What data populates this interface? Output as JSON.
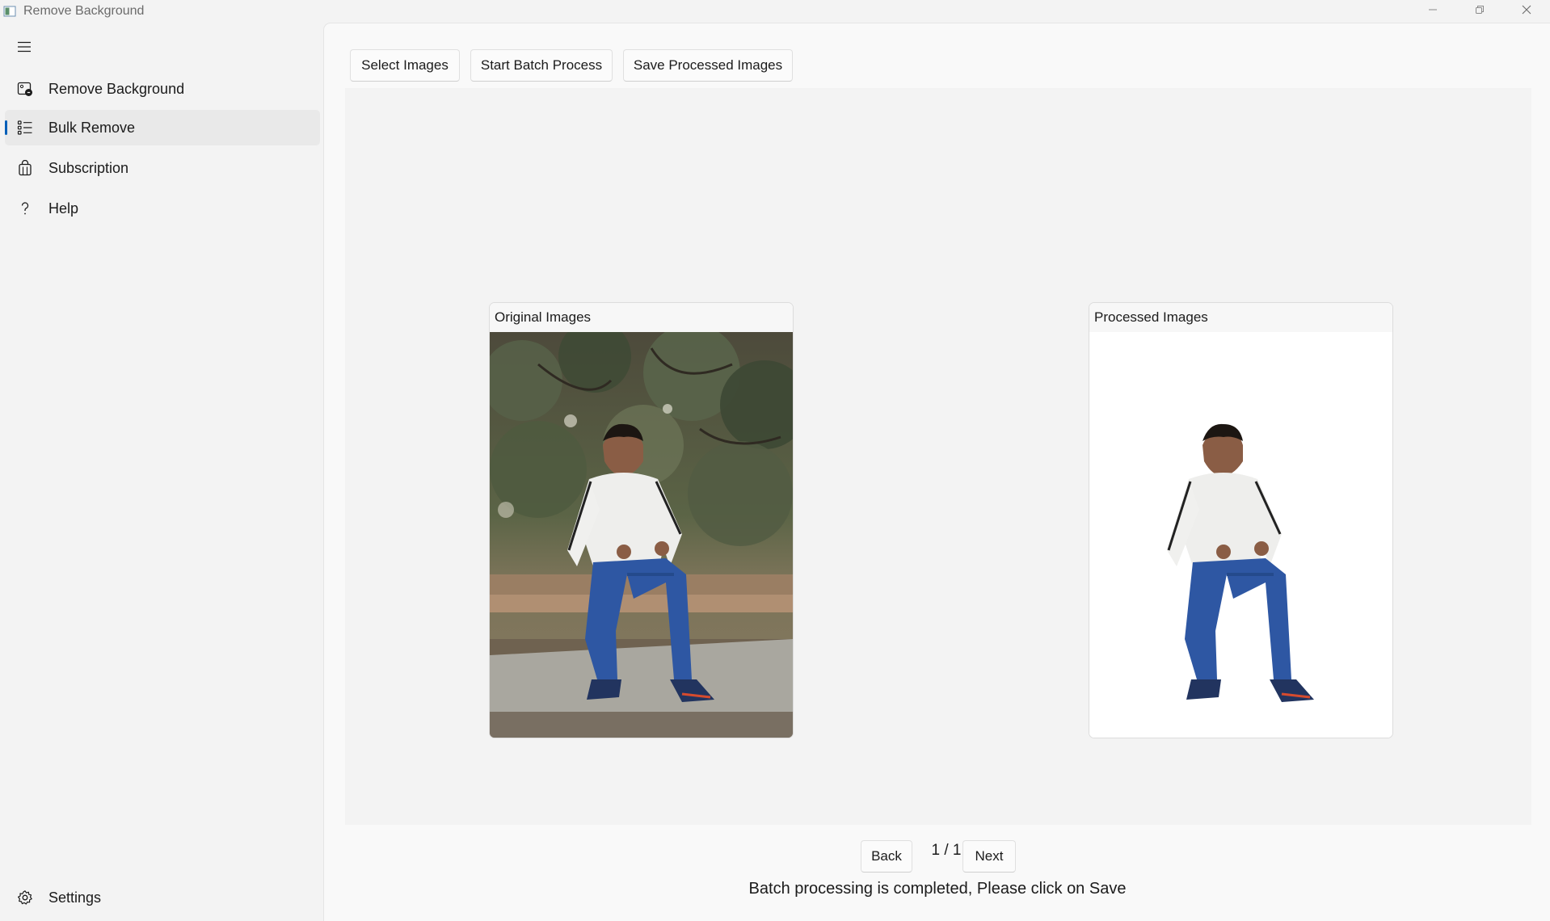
{
  "window": {
    "title": "Remove Background",
    "icons": {
      "app": "app-icon",
      "minimize": "minimize-icon",
      "restore": "restore-icon",
      "close": "close-icon"
    }
  },
  "sidebar": {
    "menu_icon": "hamburger-menu-icon",
    "items": [
      {
        "label": "Remove Background",
        "icon": "image-remove-icon",
        "selected": false
      },
      {
        "label": "Bulk Remove",
        "icon": "list-icon",
        "selected": true
      },
      {
        "label": "Subscription",
        "icon": "shopping-bag-icon",
        "selected": false
      },
      {
        "label": "Help",
        "icon": "question-mark-icon",
        "selected": false
      }
    ],
    "footer": {
      "label": "Settings",
      "icon": "gear-icon"
    }
  },
  "toolbar": {
    "select_label": "Select Images",
    "start_label": "Start Batch Process",
    "save_label": "Save Processed Images"
  },
  "panels": {
    "original_title": "Original Images",
    "processed_title": "Processed Images"
  },
  "pager": {
    "back_label": "Back",
    "page_text": "1 / 1",
    "next_label": "Next"
  },
  "status": "Batch processing is completed, Please click on Save",
  "colors": {
    "accent": "#005fb8",
    "background": "#f3f3f3",
    "content": "#f9f9f9"
  }
}
